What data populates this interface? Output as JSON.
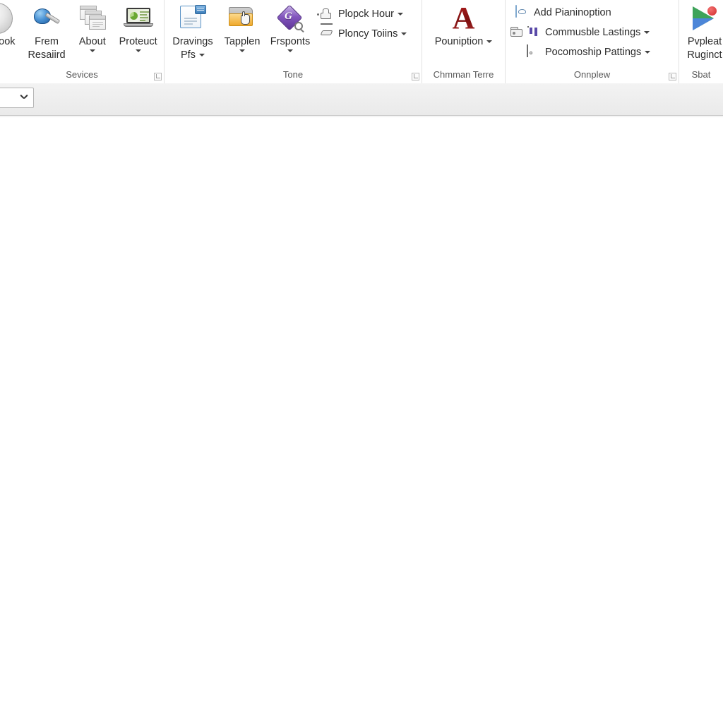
{
  "ribbon": {
    "groups": [
      {
        "name": "services",
        "label": "Sevices",
        "has_dialog_launcher": true,
        "buttons": [
          {
            "label": "ook",
            "label2": "",
            "icon": "compass-icon",
            "has_caret": false
          },
          {
            "label": "Frem",
            "label2": "Resaiird",
            "icon": "paint-helmet-icon",
            "has_caret": false
          },
          {
            "label": "About",
            "label2": "",
            "icon": "stacked-windows-icon",
            "has_caret": true
          },
          {
            "label": "Proteuct",
            "label2": "",
            "icon": "laptop-chart-icon",
            "has_caret": true
          }
        ]
      },
      {
        "name": "tone",
        "label": "Tone",
        "has_dialog_launcher": true,
        "buttons": [
          {
            "label": "Dravings",
            "label2": "Pfs",
            "icon": "blue-document-icon",
            "has_caret": true,
            "caret_inline": true
          },
          {
            "label": "Tapplen",
            "label2": "",
            "icon": "folder-hand-icon",
            "has_caret": true
          },
          {
            "label": "Frsponts",
            "label2": "",
            "icon": "purple-diamond-magnifier-icon",
            "has_caret": true
          }
        ],
        "small_buttons": [
          {
            "label": "Plopck Hour",
            "icon": "stamp-icon",
            "has_caret": true
          },
          {
            "label": "Ploncy Toiins",
            "icon": "pen-icon",
            "has_caret": true
          }
        ]
      },
      {
        "name": "chmman-terre",
        "label": "Chmman Terre",
        "has_dialog_launcher": false,
        "buttons": [
          {
            "label": "Pouniption",
            "label2": "",
            "icon": "red-letter-a-icon",
            "has_caret": true,
            "caret_inline": true
          }
        ]
      },
      {
        "name": "onnplew",
        "label": "Onnplew",
        "has_dialog_launcher": true,
        "small_buttons": [
          {
            "label": "Add Pianinoption",
            "icon": "note-icon",
            "has_caret": false
          },
          {
            "label": "Commusble Lastings",
            "icon": "chart-columns-icon",
            "has_caret": true,
            "lead_icon": "archive-icon"
          },
          {
            "label": "Pocomoship Pattings",
            "icon": "page-icon",
            "has_caret": true,
            "indent": true
          }
        ]
      },
      {
        "name": "sbat",
        "label": "Sbat",
        "has_dialog_launcher": false,
        "buttons": [
          {
            "label": "Pvpleat",
            "label2": "Ruginct",
            "icon": "maps-pin-icon",
            "has_caret": false
          }
        ]
      }
    ]
  },
  "toolbar": {
    "combo": {
      "name": "style-combo",
      "value": "",
      "placeholder": "",
      "icon": "chevron-down-icon"
    }
  },
  "canvas": {
    "name": "document-canvas",
    "content": ""
  },
  "colors": {
    "ribbon_bg": "#ffffff",
    "toolstrip_bg": "#eeeeee",
    "group_label": "#585858",
    "button_label": "#2b2b2b",
    "divider": "#e2e2e2",
    "accent_red": "#8d1414",
    "accent_blue": "#3d7fbb",
    "accent_purple": "#6a3ca5",
    "accent_green": "#3ea35a",
    "accent_orange": "#efa82c"
  }
}
